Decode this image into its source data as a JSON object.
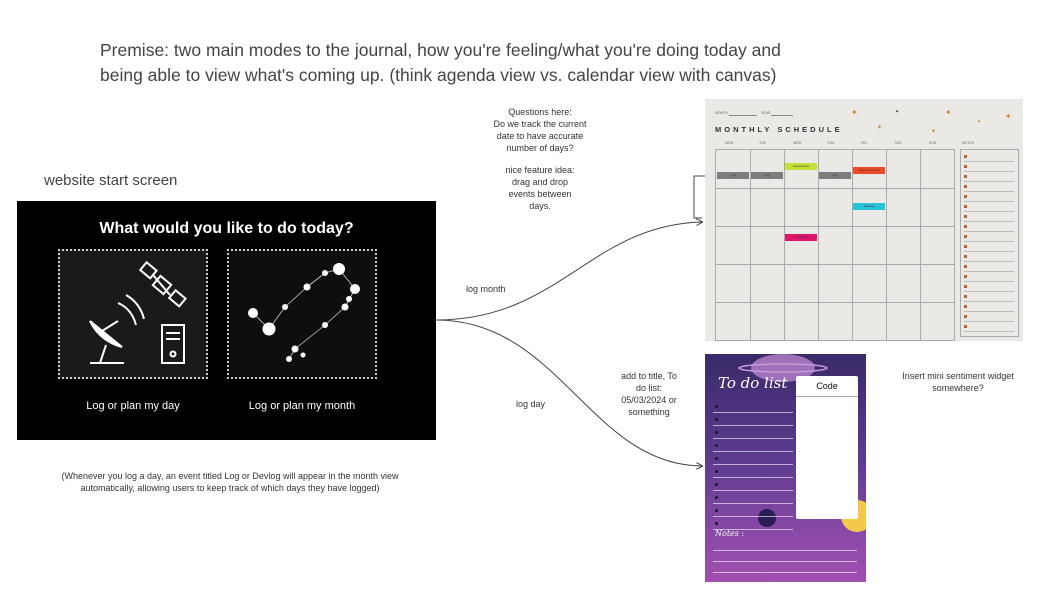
{
  "premise": {
    "line1": "Premise: two main modes to the journal, how you're feeling/what you're doing today and",
    "line2": "being able to view what's coming up. (think agenda view vs. calendar view with canvas)"
  },
  "start_screen": {
    "section_label": "website start screen",
    "title": "What would you like to do today?",
    "day_label": "Log or plan my day",
    "month_label": "Log or plan my month",
    "day_icon": "satellite-dish-icon",
    "month_icon": "constellation-icon"
  },
  "footnote": {
    "line1": "(Whenever you log a day, an event titled Log or Devlog will appear in the month view",
    "line2": "automatically, allowing users to keep track of which days they have logged)"
  },
  "connectors": {
    "log_month": "log month",
    "log_day": "log day"
  },
  "questions_note": {
    "l1": "Questions here:",
    "l2": "Do we track the current",
    "l3": "date to have accurate",
    "l4": "number of days?",
    "l5": "nice feature idea:",
    "l6": "drag and drop",
    "l7": "events between",
    "l8": "days."
  },
  "todo_note": {
    "l1": "add to title, To",
    "l2": "do list:",
    "l3": "05/03/2024 or",
    "l4": "something"
  },
  "sentiment_note": {
    "l1": "Insert mini sentiment widget",
    "l2": "somewhere?"
  },
  "calendar": {
    "month_label": "MONTH",
    "year_label": "YEAR",
    "title": "MONTHLY SCHEDULE",
    "days": [
      "MON",
      "TUE",
      "WED",
      "THU",
      "FRI",
      "SAT",
      "SUN"
    ],
    "notes_label": "NOTES",
    "events": [
      {
        "label": "Log",
        "color": "#7d7d7d"
      },
      {
        "label": "Log",
        "color": "#7d7d7d"
      },
      {
        "label": "Assessment",
        "color": "#c6e03a"
      },
      {
        "label": "Log",
        "color": "#7d7d7d"
      },
      {
        "label": "Monthly review",
        "color": "#ee4a2a"
      },
      {
        "label": "Meeting",
        "color": "#27c4d8"
      },
      {
        "label": "Birthday",
        "color": "#e0156c"
      }
    ]
  },
  "todo": {
    "title": "To do list",
    "code_label": "Code",
    "notes_label": "Notes :"
  }
}
